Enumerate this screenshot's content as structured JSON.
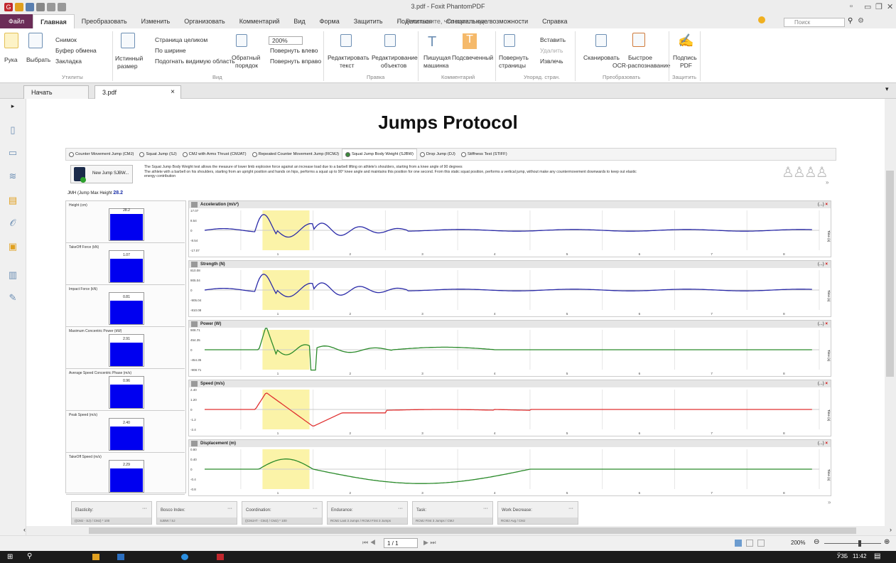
{
  "window": {
    "title": "3.pdf - Foxit PhantomPDF"
  },
  "menu": {
    "file": "Файл",
    "items": [
      "Главная",
      "Преобразовать",
      "Изменить",
      "Организовать",
      "Комментарий",
      "Вид",
      "Форма",
      "Защитить",
      "Поделиться",
      "Специальные возможности",
      "Справка"
    ],
    "tellme": "Расскажите, что хотите сдел",
    "search_placeholder": "Поиск"
  },
  "ribbon": {
    "hand": "Рука",
    "select": "Выбрать",
    "snapshot": "Снимок",
    "clipboard": "Буфер обмена",
    "bookmark": "Закладка",
    "actual_size_1": "Истинный",
    "actual_size_2": "размер",
    "fit_page": "Страница целиком",
    "fit_width": "По ширине",
    "fit_visible": "Подогнать видимую область",
    "reverse_1": "Обратный",
    "reverse_2": "порядок",
    "zoom": "200%",
    "rotate_left": "Повернуть влево",
    "rotate_right": "Повернуть вправо",
    "edit_text_1": "Редактировать",
    "edit_text_2": "текст",
    "edit_obj_1": "Редактирование",
    "edit_obj_2": "объектов",
    "typewriter_1": "Пишущая",
    "typewriter_2": "машинка",
    "highlight": "Подсвеченный",
    "rotate_pages_1": "Повернуть",
    "rotate_pages_2": "страницы",
    "insert": "Вставить",
    "delete": "Удалить",
    "extract": "Извлечь",
    "scan": "Сканировать",
    "ocr_1": "Быстрое",
    "ocr_2": "OCR-распознавание",
    "sign_1": "Подпись",
    "sign_2": "PDF",
    "groups": [
      "Утилиты",
      "Вид",
      "Правка",
      "Комментарий",
      "Упоряд. стран.",
      "Преобразовать",
      "Защитить"
    ]
  },
  "tabs": {
    "start": "Начать",
    "doc": "3.pdf",
    "close": "×"
  },
  "doc": {
    "title": "Jumps Protocol",
    "test_tabs": [
      "Counter Movement Jump (CMJ)",
      "Squat Jump (SJ)",
      "CMJ with Arms Thrust (CMJAT)",
      "Repeated Counter Movement Jump (RCMJ)",
      "Squat Jump Body Weight (SJBW)",
      "Drop Jump (DJ)",
      "Stiffness Test (STIFF)"
    ],
    "selected_tab": 4,
    "new_jump": "New Jump SJBW...",
    "description_1": "The Squat Jump Body Weight test allows the measure of lower limb explosive force against an increase load due to a barbell lifting on athlete's shoulders, starting from a knee angle of 90 degrees",
    "description_2": "The athlete with a barbell on his shoulders, starting from an upright position and hands on hips, performs a squat up to 90° knee angle and maintains this position for one second. From this static squat position, performs a vertical jump, without make any countermovement downwards to keep out elastic",
    "description_3": "energy contribution",
    "jmh_label": "JMH (Jump Max Height",
    "jmh_value": "28.2",
    "metrics": [
      {
        "label": "Height (cm)",
        "value": "28.2",
        "fill": 0.92
      },
      {
        "label": "TakeOff Force (kN)",
        "value": "1.07",
        "fill": 0.82
      },
      {
        "label": "Impact Force (kN)",
        "value": "0.81",
        "fill": 0.82
      },
      {
        "label": "Maximum Concentric Power (kW)",
        "value": "2.91",
        "fill": 0.82
      },
      {
        "label": "Average Speed Concentric Phase (m/s)",
        "value": "0.96",
        "fill": 0.82
      },
      {
        "label": "Peak Speed (m/s)",
        "value": "2.40",
        "fill": 0.82
      },
      {
        "label": "TakeOff Speed (m/s)",
        "value": "2.29",
        "fill": 0.82
      }
    ],
    "charts": [
      {
        "title": "Acceleration (m/s²)",
        "ticks": [
          "17.07",
          "8.54",
          "0",
          "-8.54",
          "-17.07"
        ],
        "color": "#2a2aa8"
      },
      {
        "title": "Strength (N)",
        "ticks": [
          "810.08",
          "905.04",
          "0",
          "-905.04",
          "-810.08"
        ],
        "color": "#2a2aa8"
      },
      {
        "title": "Power (W)",
        "ticks": [
          "908.71",
          "454.35",
          "0",
          "-454.35",
          "-908.71"
        ],
        "color": "#2a8a2a"
      },
      {
        "title": "Speed (m/s)",
        "ticks": [
          "2.40",
          "1.20",
          "0",
          "-1.2",
          "-2.4"
        ],
        "color": "#e03030"
      },
      {
        "title": "Displacement (m)",
        "ticks": [
          "0.80",
          "0.40",
          "0",
          "-0.4",
          "-0.8"
        ],
        "color": "#2a8a2a"
      }
    ],
    "x_ticks": [
      "1",
      "2",
      "3",
      "4",
      "5",
      "6",
      "7",
      "8"
    ],
    "time_label": "Time (s)",
    "chart_ctrl": "(...)",
    "cards": [
      {
        "title": "Elasticity:",
        "formula": "((CMJ - SJ) / CMJ) * 100"
      },
      {
        "title": "Bosco Index:",
        "formula": "SJBW / SJ"
      },
      {
        "title": "Coordination:",
        "formula": "((CMJAT - CMJ) / CMJ) * 100"
      },
      {
        "title": "Endurance:",
        "formula": "RCMJ Last 3 Jumps / RCMJ First 3 Jumps"
      },
      {
        "title": "Task:",
        "formula": "RCMJ First 3 Jumps / CMJ"
      },
      {
        "title": "Work Decrease:",
        "formula": "RCMJ Avg / CMJ"
      }
    ],
    "card_menu": "···"
  },
  "status": {
    "page": "1 / 1",
    "zoom": "200%"
  },
  "taskbar": {
    "lang": "ЎЗБ",
    "time": "11:42"
  }
}
